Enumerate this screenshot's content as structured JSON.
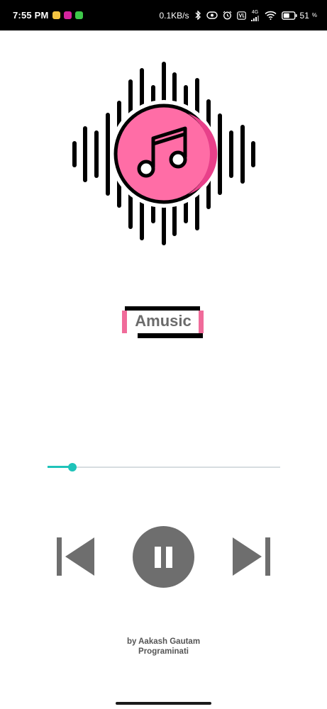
{
  "status_bar": {
    "time": "7:55 PM",
    "speed": "0.1KB/s",
    "network": "4G",
    "battery_percent": "51",
    "notification_colors": [
      "#f5c542",
      "#d6249f",
      "#3ec84a"
    ],
    "icons": [
      "bluetooth-icon",
      "vibrate-icon",
      "alarm-icon",
      "volte-icon",
      "signal-icon",
      "wifi-icon",
      "battery-icon"
    ]
  },
  "app": {
    "name": "Amusic",
    "credit_line1": "by Aakash Gautam",
    "credit_line2": "Programinati"
  },
  "player": {
    "progress_fraction": 0.106,
    "state": "playing",
    "controls": [
      "previous",
      "pause",
      "next"
    ]
  },
  "colors": {
    "accent": "#1fc3b9",
    "brand_pink": "#f06b9a",
    "disc_pink": "#ff6da6",
    "control_gray": "#6e6e6e"
  }
}
